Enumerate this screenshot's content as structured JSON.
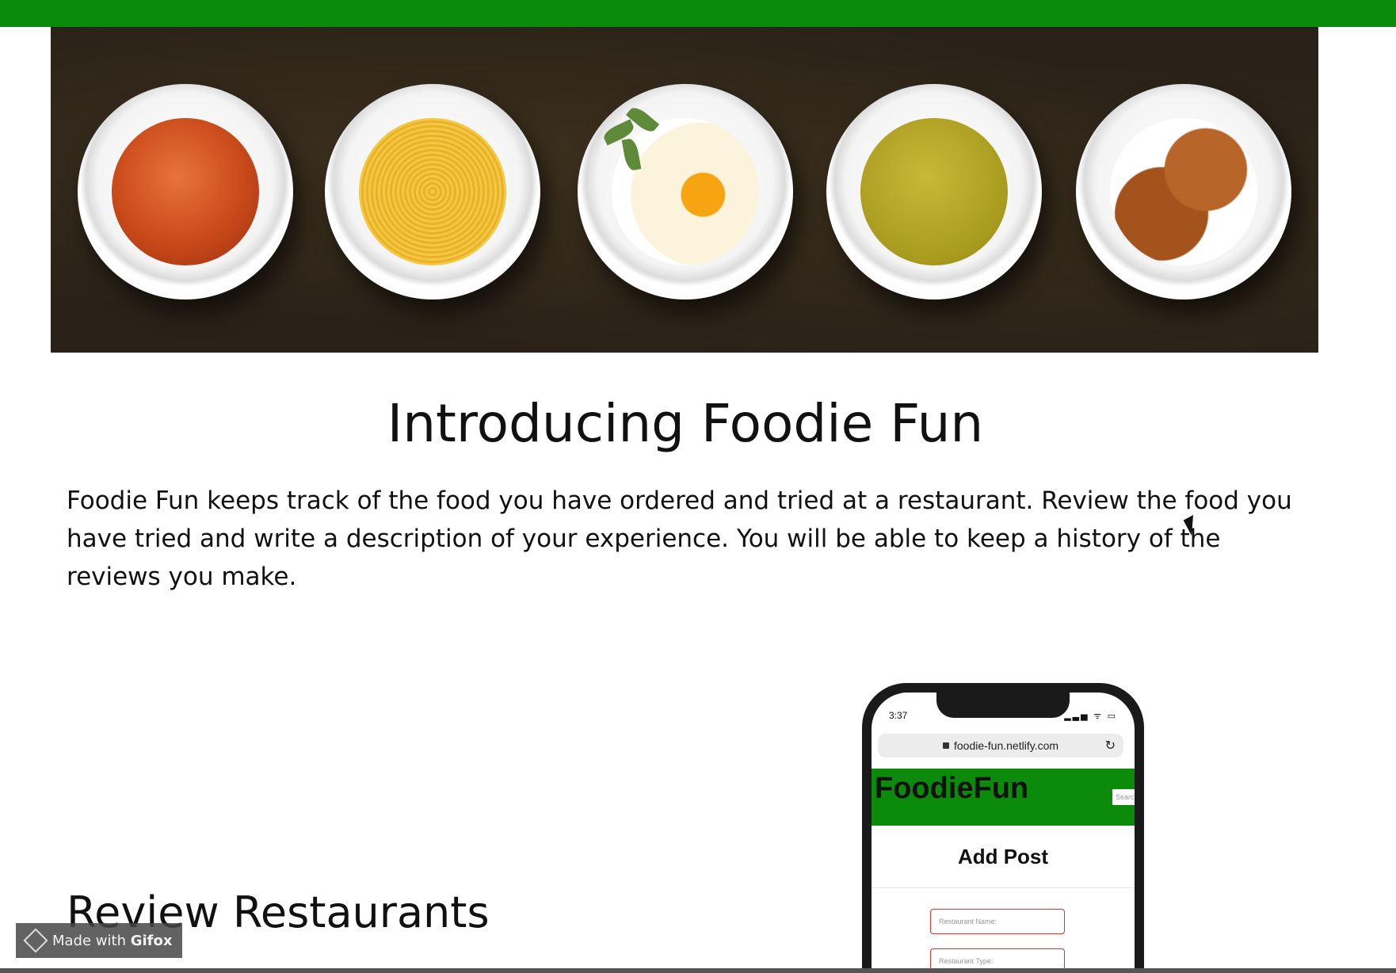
{
  "hero": {
    "plates": [
      {
        "name": "soup-plate"
      },
      {
        "name": "spaghetti-plate"
      },
      {
        "name": "egg-plate"
      },
      {
        "name": "pea-soup-plate"
      },
      {
        "name": "croissant-plate"
      }
    ]
  },
  "main": {
    "title": "Introducing Foodie Fun",
    "intro": "Foodie Fun keeps track of the food you have ordered and tried at a restaurant. Review the food you have tried and write a description of your experience. You will be able to keep a history of the reviews you make.",
    "section_title": "Review Restaurants"
  },
  "phone": {
    "time": "3:37",
    "status_icons": "▂▃▅ ᯤ ▭",
    "url": "foodie-fun.netlify.com",
    "reload_icon": "↻",
    "app": {
      "brand": "FoodieFun",
      "search_placeholder": "Searc",
      "page_title": "Add Post",
      "fields": [
        {
          "placeholder": "Restaurant Name:"
        },
        {
          "placeholder": "Restaurant Type:"
        }
      ]
    }
  },
  "watermark": {
    "prefix": "Made with ",
    "brand": "Gifox"
  },
  "colors": {
    "brand_green": "#0b8a0b",
    "input_border": "#e0312a"
  }
}
